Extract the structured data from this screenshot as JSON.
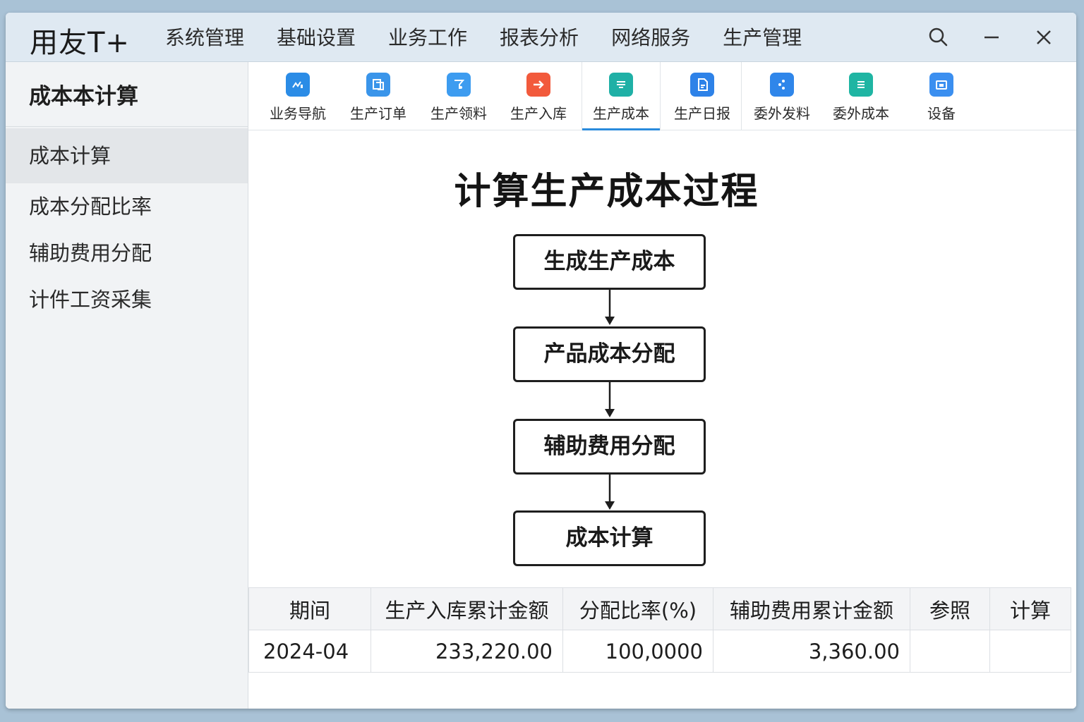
{
  "app": {
    "title": "用友T+"
  },
  "menu": [
    "系统管理",
    "基础设置",
    "业务工作",
    "报表分析",
    "网络服务",
    "生产管理"
  ],
  "window_controls": {
    "search": "search-icon",
    "minimize": "minimize-icon",
    "close": "close-icon"
  },
  "sidebar": {
    "title": "成本本计算",
    "items": [
      "成本计算",
      "成本分配比率",
      "辅助费用分配",
      "计件工资采集"
    ],
    "active": "成本计算"
  },
  "toolbar": {
    "items": [
      {
        "label": "业务导航",
        "color": "#2b8ce6",
        "icon": "chart-icon"
      },
      {
        "label": "生产订单",
        "color": "#3a95ea",
        "icon": "document-icon"
      },
      {
        "label": "生产领料",
        "color": "#3d9cf0",
        "icon": "material-icon"
      },
      {
        "label": "生产入库",
        "color": "#f25a3c",
        "icon": "arrow-right-icon"
      },
      {
        "label": "生产成本",
        "color": "#1fb0a6",
        "icon": "cost-icon"
      },
      {
        "label": "生产日报",
        "color": "#2e82e8",
        "icon": "report-icon"
      },
      {
        "label": "委外发料",
        "color": "#2f86ea",
        "icon": "dots-icon"
      },
      {
        "label": "委外成本",
        "color": "#1fb5a3",
        "icon": "list-icon"
      },
      {
        "label": "设备",
        "color": "#3b8ff0",
        "icon": "device-icon"
      }
    ],
    "active_index": 4
  },
  "flow": {
    "title": "计算生产成本过程",
    "steps": [
      "生成生产成本",
      "产品成本分配",
      "辅助费用分配",
      "成本计算"
    ]
  },
  "table": {
    "headers": [
      "期间",
      "生产入库累计金额",
      "分配比率(%)",
      "辅助费用累计金额",
      "参照",
      "计算"
    ],
    "rows": [
      [
        "2024-04",
        "233,220.00",
        "100,0000",
        "3,360.00",
        "",
        ""
      ]
    ]
  }
}
